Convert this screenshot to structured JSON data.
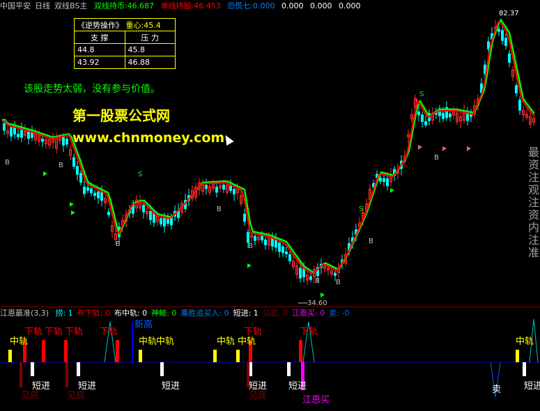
{
  "header": {
    "stock": "中国平安",
    "period": "日线",
    "indicator": "双线BS主",
    "double_line_label": "双线持币:",
    "double_line_value": "46.687",
    "single_line_label": "单线持股:",
    "single_line_value": "46.453",
    "extra_label": "恐慌七:",
    "extra_values": [
      "0.000",
      "0.000",
      "0.000",
      "0.000"
    ]
  },
  "info_table": {
    "title": "《逆势操作》",
    "center_label": "重心:",
    "center_value": "45.4",
    "support_header": "支 撑",
    "pressure_header": "压 力",
    "rows": [
      [
        "44.8",
        "45.8"
      ],
      [
        "43.92",
        "46.88"
      ]
    ]
  },
  "comment": "该股走势太弱，没有参与价值。",
  "watermark": {
    "site_name": "第一股票公式网",
    "url": "www.chnmoney.com"
  },
  "price_labels": {
    "low": "34.60",
    "high": "82.37"
  },
  "side_text": "最 资 注 观 注 资 内 注 准",
  "subchart_header": {
    "name": "江恩最准(3,3)",
    "items": [
      {
        "label": "捞:",
        "value": "1",
        "color": "#00ffff"
      },
      {
        "label": "布下轨:",
        "value": "0",
        "color": "#ff0000"
      },
      {
        "label": "布中轨:",
        "value": "0",
        "color": "#ffffff"
      },
      {
        "label": "神鲸:",
        "value": "0",
        "color": "#00ff00"
      },
      {
        "label": "乘胜追买入:",
        "value": "0",
        "color": "#0080ff"
      },
      {
        "label": "短进:",
        "value": "1",
        "color": "#ffffff"
      },
      {
        "label": "见底:",
        "value": "0",
        "color": "#800000"
      },
      {
        "label": "江恩买:",
        "value": "0",
        "color": "#ff00ff"
      },
      {
        "label": "卖:",
        "value": "-0",
        "color": "#0060ff"
      }
    ]
  },
  "signals": {
    "zhonggui": "中轨",
    "xiagui": "下轨",
    "duanjin": "短进",
    "jiandi": "见底",
    "jiangenmai": "江恩买",
    "mai_sell": "卖",
    "b_label": "B",
    "s_label": "S",
    "new_high": "新高"
  },
  "colors": {
    "up": "#ff3030",
    "down": "#00ffff",
    "line_red": "#ff0000",
    "line_green": "#00ff00",
    "axis": "#800000",
    "yellow": "#ffff00"
  }
}
